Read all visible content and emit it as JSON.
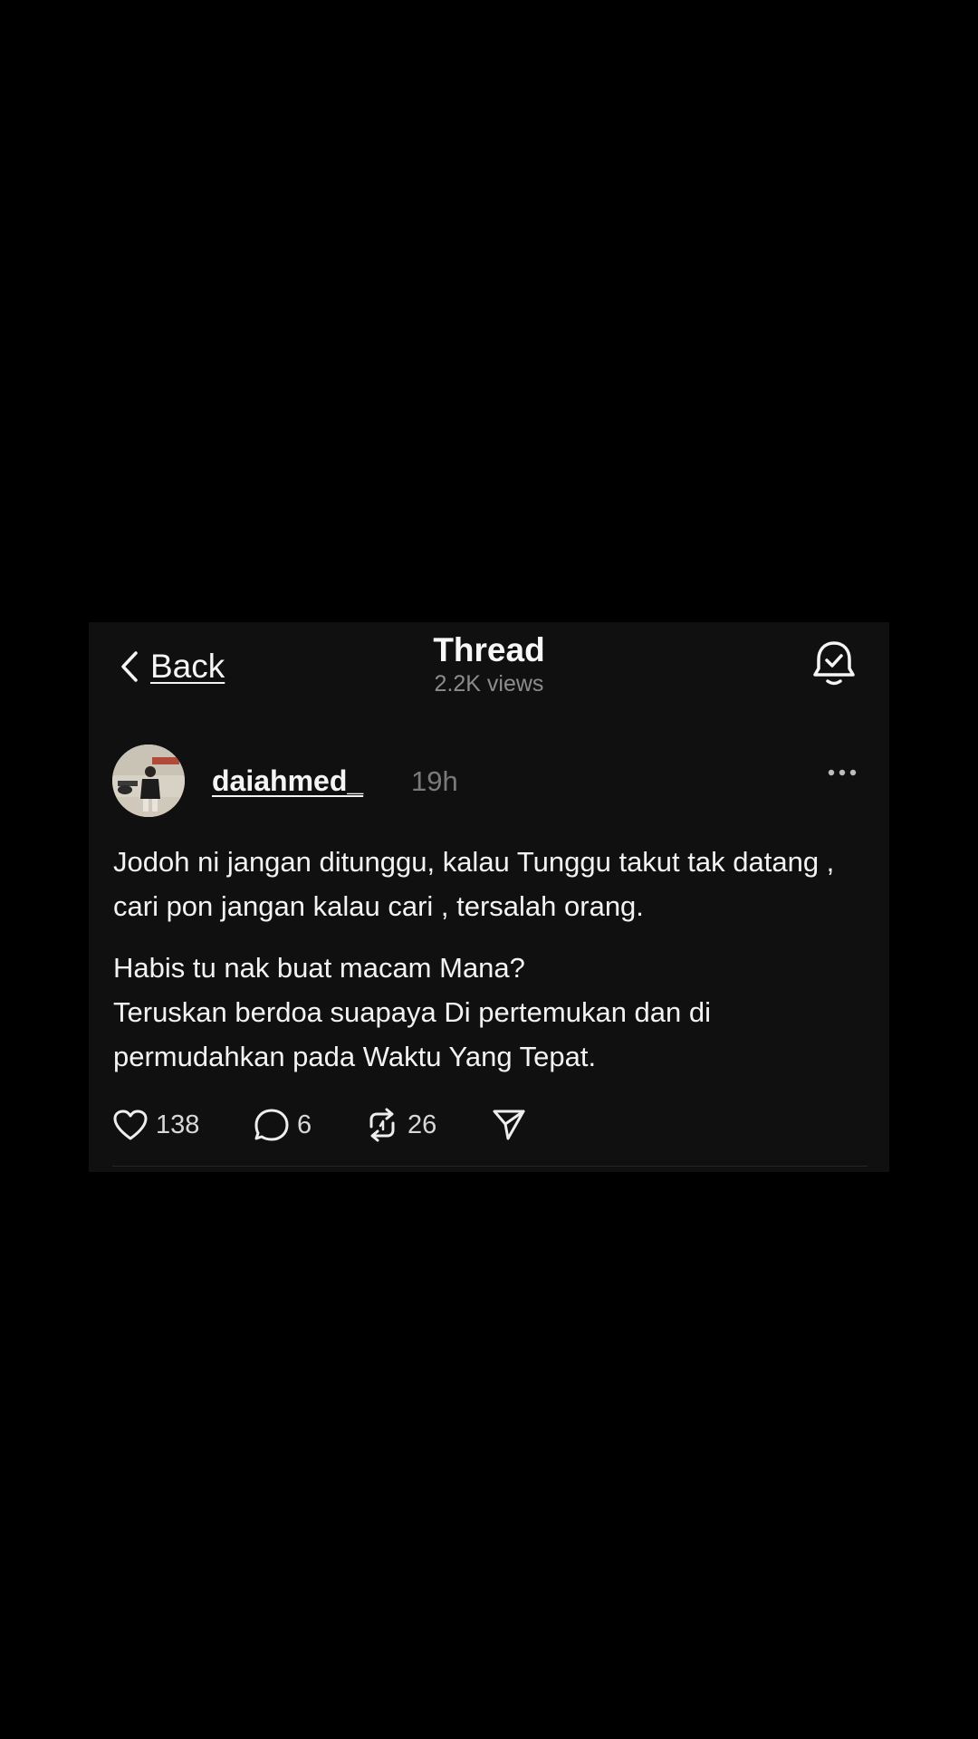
{
  "header": {
    "back_label": "Back",
    "title": "Thread",
    "views": "2.2K views",
    "bell_icon": "bell-check-icon",
    "back_icon": "chevron-left-icon"
  },
  "post": {
    "username": "daiahmed_",
    "time": "19h",
    "more_icon": "ellipsis-icon",
    "paragraphs": [
      "Jodoh ni jangan ditunggu, kalau Tunggu takut tak datang , cari pon jangan kalau cari , tersalah orang.",
      "Habis tu nak buat macam Mana?",
      "Teruskan berdoa suapaya Di pertemukan dan di permudahkan pada Waktu Yang Tepat."
    ],
    "actions": {
      "likes": "138",
      "replies": "6",
      "reposts": "26",
      "like_icon": "heart-icon",
      "reply_icon": "speech-bubble-icon",
      "repost_icon": "repost-icon",
      "share_icon": "send-icon"
    }
  },
  "colors": {
    "background": "#000000",
    "card": "#101010",
    "text": "#f5f5f5",
    "muted": "#8c8c8c"
  }
}
